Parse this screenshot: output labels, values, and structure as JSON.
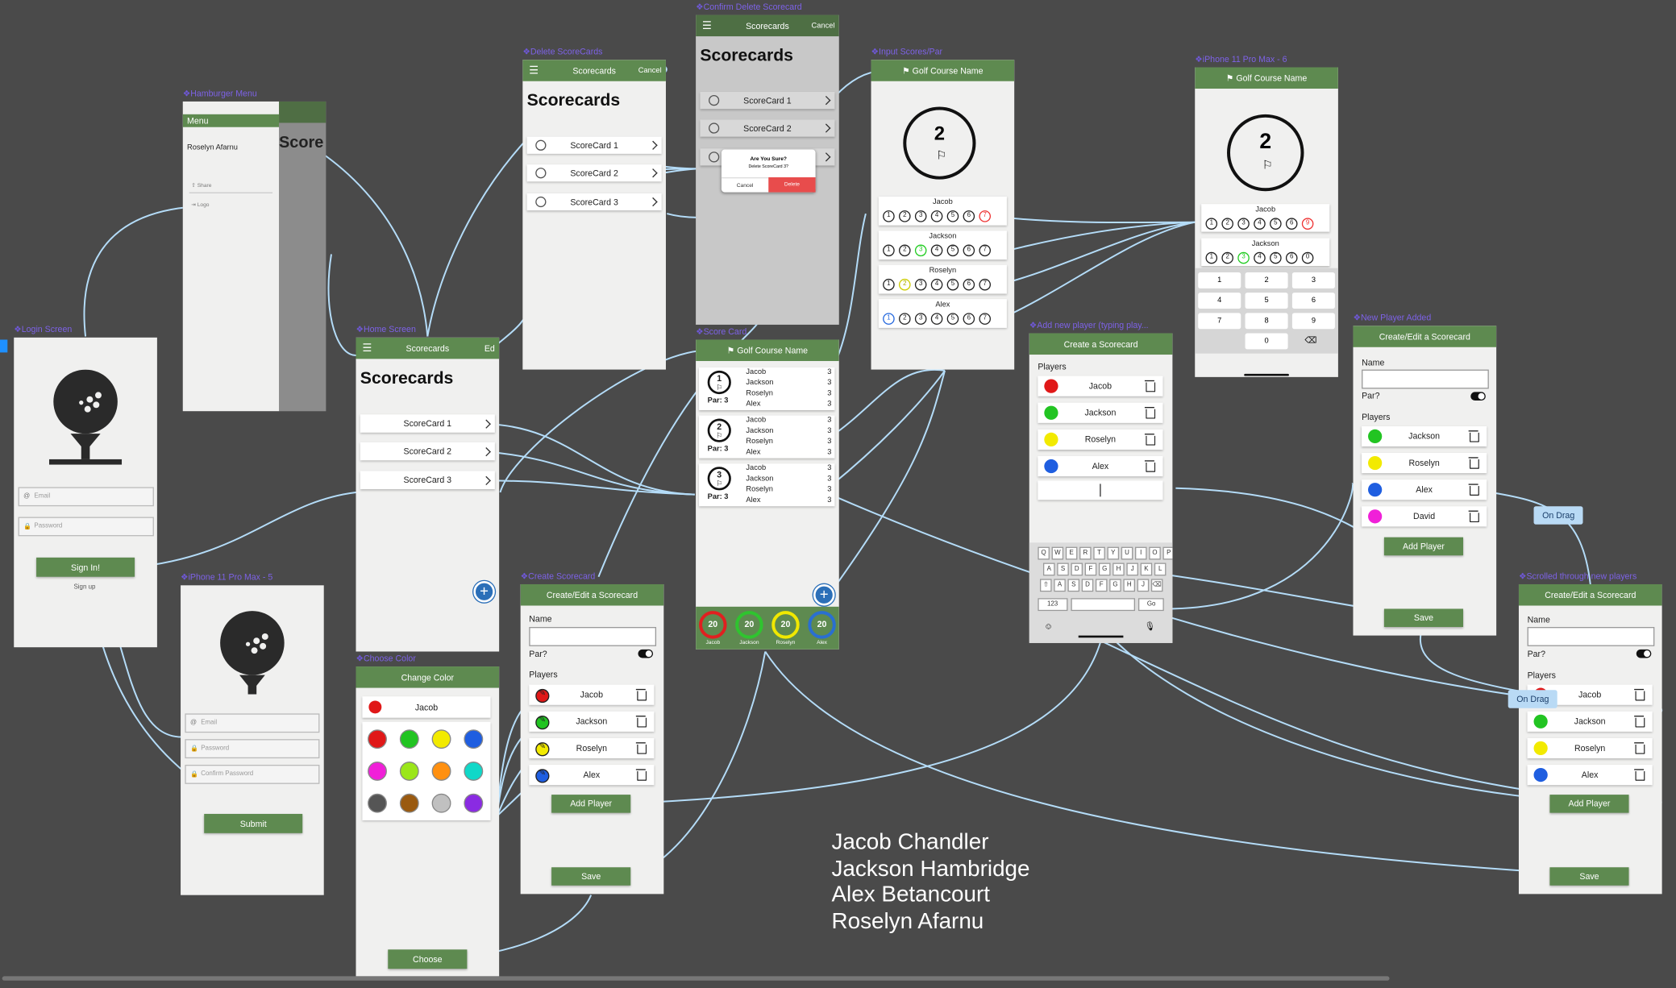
{
  "frame_labels": {
    "hamburger": "Hamburger Menu",
    "login": "Login Screen",
    "home": "Home Screen",
    "delete": "Delete ScoreCards",
    "confirm": "Confirm Delete Scorecard",
    "input": "Input Scores/Par",
    "iphone6": "iPhone 11 Pro Max - 6",
    "scorecard": "Score Card",
    "addplayer": "Add new player (typing play...",
    "newplayer": "New Player Added",
    "iphone5": "iPhone 11 Pro Max - 5",
    "choosecolor": "Choose Color",
    "create": "Create Scorecard",
    "scrolled": "Scrolled through new players"
  },
  "hamburger": {
    "menu": "Menu",
    "user": "Roselyn Afarnu",
    "share": "Share",
    "logout": "Logo"
  },
  "login": {
    "email": "Email",
    "password": "Password",
    "signin": "Sign In!",
    "signup": "Sign up"
  },
  "signup": {
    "email": "Email",
    "password": "Password",
    "confirm": "Confirm Password",
    "submit": "Submit"
  },
  "home": {
    "nav_title": "Scorecards",
    "edit": "Ed",
    "title": "Scorecards",
    "items": [
      "ScoreCard 1",
      "ScoreCard 2",
      "ScoreCard 3"
    ]
  },
  "delete": {
    "nav_title": "Scorecards",
    "cancel": "Cancel",
    "title": "Scorecards",
    "items": [
      "ScoreCard 1",
      "ScoreCard 2",
      "ScoreCard 3"
    ]
  },
  "confirm": {
    "nav_title": "Scorecards",
    "cancel": "Cancel",
    "title": "Scorecards",
    "items": [
      "ScoreCard 1",
      "ScoreCard 2"
    ],
    "dialog_title": "Are You Sure?",
    "dialog_msg": "Delete ScoreCard 3?",
    "dialog_cancel": "Cancel",
    "dialog_delete": "Delete"
  },
  "input": {
    "course": "Golf Course Name",
    "hole": "2",
    "players": [
      "Jacob",
      "Jackson",
      "Roselyn",
      "Alex"
    ]
  },
  "iphone6": {
    "course": "Golf Course Name",
    "hole": "2",
    "players": [
      "Jacob",
      "Jackson"
    ],
    "keys": [
      [
        "1",
        "2",
        "3"
      ],
      [
        "4",
        "5",
        "6"
      ],
      [
        "7",
        "8",
        "9"
      ],
      [
        "0"
      ]
    ]
  },
  "scorecard": {
    "course": "Golf Course Name",
    "holes": [
      {
        "num": "1",
        "par": "Par: 3",
        "players": [
          "Jacob",
          "Jackson",
          "Roselyn",
          "Alex"
        ],
        "scores": [
          "3",
          "3",
          "3",
          "3"
        ]
      },
      {
        "num": "2",
        "par": "Par: 3",
        "players": [
          "Jacob",
          "Jackson",
          "Roselyn",
          "Alex"
        ],
        "scores": [
          "3",
          "3",
          "3",
          "3"
        ]
      },
      {
        "num": "3",
        "par": "Par: 3",
        "players": [
          "Jacob",
          "Jackson",
          "Roselyn",
          "Alex"
        ],
        "scores": [
          "3",
          "3",
          "3",
          "3"
        ]
      }
    ],
    "totals": [
      {
        "score": "20",
        "name": "Jacob",
        "color": "#e02020"
      },
      {
        "score": "20",
        "name": "Jackson",
        "color": "#2fc42f"
      },
      {
        "score": "20",
        "name": "Roselyn",
        "color": "#f0e800"
      },
      {
        "score": "20",
        "name": "Alex",
        "color": "#2a6fd0"
      }
    ]
  },
  "addplayer": {
    "header": "Create a Scorecard",
    "players_label": "Players",
    "players": [
      {
        "name": "Jacob",
        "color": "#e01818"
      },
      {
        "name": "Jackson",
        "color": "#22c422"
      },
      {
        "name": "Roselyn",
        "color": "#f2ea00"
      },
      {
        "name": "Alex",
        "color": "#1f5ee0"
      }
    ]
  },
  "newplayer": {
    "header": "Create/Edit a Scorecard",
    "name_label": "Name",
    "par_label": "Par?",
    "players_label": "Players",
    "players": [
      {
        "name": "Jackson",
        "color": "#22c422"
      },
      {
        "name": "Roselyn",
        "color": "#f2ea00"
      },
      {
        "name": "Alex",
        "color": "#1f5ee0"
      },
      {
        "name": "David",
        "color": "#f020d8"
      }
    ],
    "add": "Add Player",
    "save": "Save"
  },
  "choosecolor": {
    "header": "Change Color",
    "player": "Jacob",
    "choose": "Choose",
    "swatches": [
      "#e01818",
      "#22c422",
      "#f2ea00",
      "#1f5ee0",
      "#f020d8",
      "#9be61a",
      "#ff9010",
      "#10d8c8",
      "#555555",
      "#9a5a10",
      "#c0c0c0",
      "#8a2be2"
    ]
  },
  "create": {
    "header": "Create/Edit a Scorecard",
    "name_label": "Name",
    "par_label": "Par?",
    "players_label": "Players",
    "players": [
      {
        "name": "Jacob",
        "color": "#e01818"
      },
      {
        "name": "Jackson",
        "color": "#22c422"
      },
      {
        "name": "Roselyn",
        "color": "#f2ea00"
      },
      {
        "name": "Alex",
        "color": "#1f5ee0"
      }
    ],
    "add": "Add Player",
    "save": "Save"
  },
  "scrolled": {
    "header": "Create/Edit a Scorecard",
    "name_label": "Name",
    "par_label": "Par?",
    "players_label": "Players",
    "players": [
      {
        "name": "Jacob",
        "color": "#e01818"
      },
      {
        "name": "Jackson",
        "color": "#22c422"
      },
      {
        "name": "Roselyn",
        "color": "#f2ea00"
      },
      {
        "name": "Alex",
        "color": "#1f5ee0"
      }
    ],
    "add": "Add Player",
    "save": "Save"
  },
  "drag_tags": [
    "On Drag",
    "On Drag"
  ],
  "credits": [
    "Jacob Chandler",
    "Jackson Hambridge",
    "Alex Betancourt",
    "Roselyn Afarnu"
  ]
}
